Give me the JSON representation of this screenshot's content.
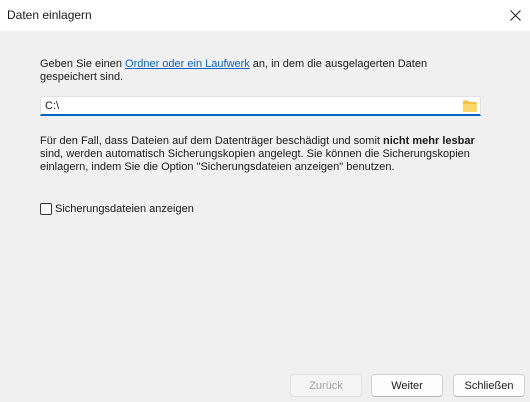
{
  "window": {
    "title": "Daten einlagern",
    "close_icon": "close-icon"
  },
  "description": {
    "prefix": "Geben Sie einen ",
    "link": "Ordner oder ein Laufwerk",
    "suffix": " an, in dem die ausgelagerten Daten gespeichert sind."
  },
  "path_field": {
    "value": "C:\\",
    "folder_icon": "folder-icon"
  },
  "info": {
    "part1": "Für den Fall, dass Dateien auf dem Datenträger beschädigt und somit ",
    "bold": "nicht mehr lesbar",
    "part2": " sind, werden automatisch Sicherungskopien angelegt. Sie können die Sicherungskopien einlagern, indem Sie die Option \"Sicherungsdateien anzeigen\" benutzen."
  },
  "checkbox": {
    "label": "Sicherungsdateien anzeigen",
    "checked": false
  },
  "buttons": {
    "back": "Zurück",
    "next": "Weiter",
    "close": "Schließen"
  },
  "colors": {
    "accent": "#0067c0",
    "link": "#0b62c4",
    "folder": "#f4c23f",
    "background": "#f0f0f0"
  }
}
